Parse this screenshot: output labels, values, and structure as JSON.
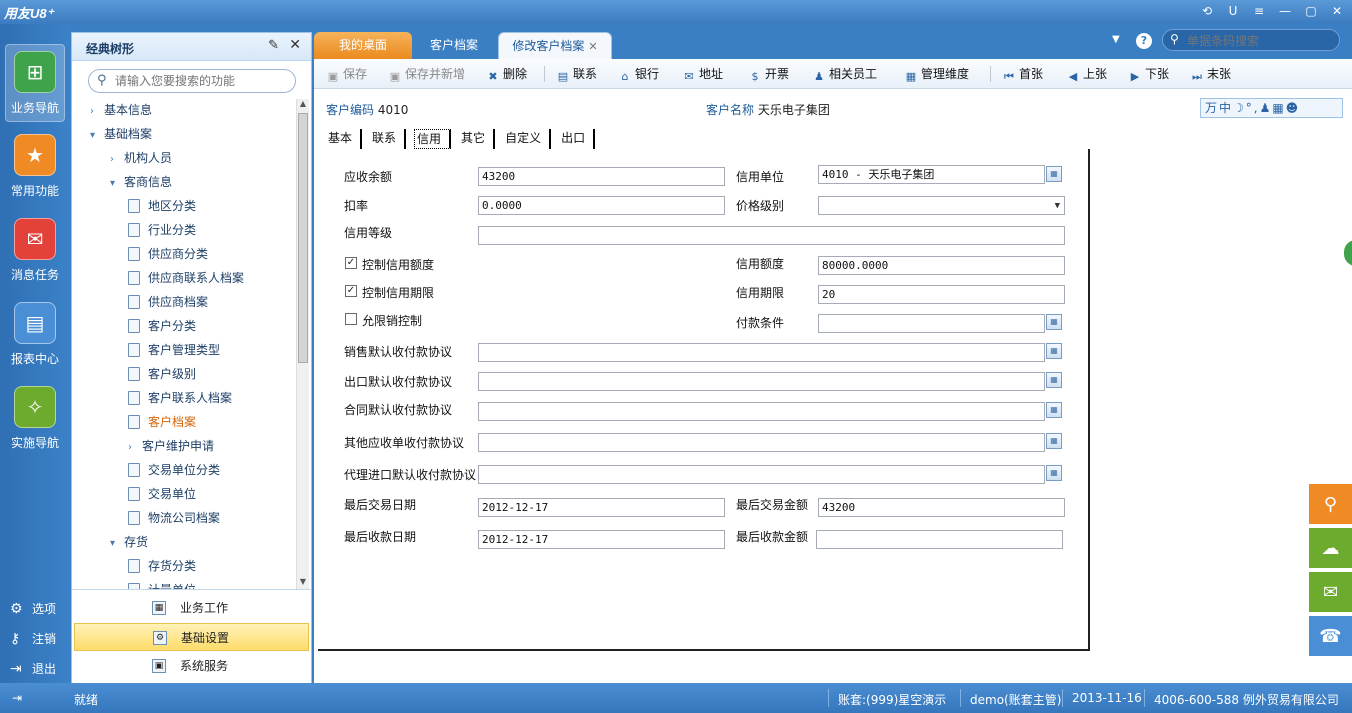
{
  "app": {
    "logo": "用友U8⁺"
  },
  "window_controls": [
    "⟲",
    "U",
    "≡",
    "—",
    "▢",
    "✕"
  ],
  "left_nav": {
    "items": [
      {
        "label": "业务导航",
        "icon": "org-chart-icon",
        "color": "#3ea34a"
      },
      {
        "label": "常用功能",
        "icon": "star-icon",
        "color": "#f08a24"
      },
      {
        "label": "消息任务",
        "icon": "mail-icon",
        "color": "#e2423a"
      },
      {
        "label": "报表中心",
        "icon": "report-icon",
        "color": "#4a8fd6"
      },
      {
        "label": "实施导航",
        "icon": "compass-icon",
        "color": "#6cab2e"
      }
    ],
    "bottom": [
      {
        "label": "选项",
        "icon": "gear-icon"
      },
      {
        "label": "注销",
        "icon": "key-icon"
      },
      {
        "label": "退出",
        "icon": "exit-icon"
      }
    ]
  },
  "tree": {
    "title": "经典树形",
    "search_placeholder": "请输入您要搜索的功能",
    "nodes": [
      {
        "label": "基本信息",
        "type": "folder",
        "level": 0,
        "expanded": false
      },
      {
        "label": "基础档案",
        "type": "folder",
        "level": 0,
        "expanded": true
      },
      {
        "label": "机构人员",
        "type": "folder",
        "level": 1,
        "expanded": false
      },
      {
        "label": "客商信息",
        "type": "folder",
        "level": 1,
        "expanded": true
      },
      {
        "label": "地区分类",
        "type": "doc",
        "level": 2
      },
      {
        "label": "行业分类",
        "type": "doc",
        "level": 2
      },
      {
        "label": "供应商分类",
        "type": "doc",
        "level": 2
      },
      {
        "label": "供应商联系人档案",
        "type": "doc",
        "level": 2
      },
      {
        "label": "供应商档案",
        "type": "doc",
        "level": 2
      },
      {
        "label": "客户分类",
        "type": "doc",
        "level": 2
      },
      {
        "label": "客户管理类型",
        "type": "doc",
        "level": 2
      },
      {
        "label": "客户级别",
        "type": "doc",
        "level": 2
      },
      {
        "label": "客户联系人档案",
        "type": "doc",
        "level": 2
      },
      {
        "label": "客户档案",
        "type": "doc",
        "level": 2,
        "selected": true
      },
      {
        "label": "客户维护申请",
        "type": "folder",
        "level": 2,
        "expanded": false
      },
      {
        "label": "交易单位分类",
        "type": "doc",
        "level": 2
      },
      {
        "label": "交易单位",
        "type": "doc",
        "level": 2
      },
      {
        "label": "物流公司档案",
        "type": "doc",
        "level": 2
      },
      {
        "label": "存货",
        "type": "folder",
        "level": 1,
        "expanded": true
      },
      {
        "label": "存货分类",
        "type": "doc",
        "level": 2
      },
      {
        "label": "计量单位",
        "type": "doc",
        "level": 2
      }
    ],
    "bottom": [
      {
        "label": "业务工作",
        "active": false
      },
      {
        "label": "基础设置",
        "active": true
      },
      {
        "label": "系统服务",
        "active": false
      }
    ]
  },
  "tabs": [
    {
      "label": "我的桌面"
    },
    {
      "label": "客户档案"
    },
    {
      "label": "修改客户档案",
      "close": "✕"
    }
  ],
  "top_search": {
    "placeholder": "单据条码搜索"
  },
  "toolbar": [
    {
      "label": "保存",
      "icon": "save-icon",
      "disabled": true
    },
    {
      "label": "保存并新增",
      "icon": "save-new-icon",
      "disabled": true
    },
    {
      "label": "删除",
      "icon": "delete-icon",
      "disabled": false
    },
    {
      "label": "联系",
      "icon": "contact-icon",
      "disabled": false
    },
    {
      "label": "银行",
      "icon": "bank-icon",
      "disabled": false
    },
    {
      "label": "地址",
      "icon": "address-icon",
      "disabled": false
    },
    {
      "label": "开票",
      "icon": "invoice-icon",
      "disabled": false
    },
    {
      "label": "相关员工",
      "icon": "staff-icon",
      "disabled": false
    },
    {
      "label": "管理维度",
      "icon": "dimension-icon",
      "disabled": false
    },
    {
      "label": "首张",
      "icon": "first-icon",
      "disabled": false
    },
    {
      "label": "上张",
      "icon": "prev-icon",
      "disabled": false
    },
    {
      "label": "下张",
      "icon": "next-icon",
      "disabled": false
    },
    {
      "label": "末张",
      "icon": "last-icon",
      "disabled": false
    }
  ],
  "header": {
    "code_label": "客户编码",
    "code_value": "4010",
    "name_label": "客户名称",
    "name_value": "天乐电子集团",
    "ime": "万中☽°,♟▦☻"
  },
  "subtabs": [
    "基本",
    "联系",
    "信用",
    "其它",
    "自定义",
    "出口"
  ],
  "form": {
    "ar_balance": {
      "label": "应收余额",
      "value": "43200"
    },
    "credit_unit": {
      "label": "信用单位",
      "value": "4010 - 天乐电子集团"
    },
    "discount": {
      "label": "扣率",
      "value": "0.0000"
    },
    "price_level": {
      "label": "价格级别",
      "value": ""
    },
    "credit_grade": {
      "label": "信用等级",
      "value": ""
    },
    "ctrl_credit_amount": {
      "label": "控制信用额度",
      "checked": true
    },
    "credit_amount": {
      "label": "信用额度",
      "value": "80000.0000"
    },
    "ctrl_credit_period": {
      "label": "控制信用期限",
      "checked": true
    },
    "credit_period": {
      "label": "信用期限",
      "value": "20"
    },
    "limit_sales": {
      "label": "允限销控制",
      "checked": false
    },
    "payment_terms": {
      "label": "付款条件",
      "value": ""
    },
    "sales_agreement": {
      "label": "销售默认收付款协议",
      "value": ""
    },
    "export_agreement": {
      "label": "出口默认收付款协议",
      "value": ""
    },
    "contract_agreement": {
      "label": "合同默认收付款协议",
      "value": ""
    },
    "other_ar_agreement": {
      "label": "其他应收单收付款协议",
      "value": ""
    },
    "agency_import_agreement": {
      "label": "代理进口默认收付款协议",
      "value": ""
    },
    "last_trade_date": {
      "label": "最后交易日期",
      "value": "2012-12-17"
    },
    "last_trade_amount": {
      "label": "最后交易金额",
      "value": "43200"
    },
    "last_receipt_date": {
      "label": "最后收款日期",
      "value": "2012-12-17"
    },
    "last_receipt_amount": {
      "label": "最后收款金额",
      "value": ""
    }
  },
  "status": {
    "ready": "就绪",
    "account": "账套:(999)星空演示",
    "user": "demo(账套主管)",
    "date": "2013-11-16",
    "company": "4006-600-588 例外贸易有限公司"
  },
  "colors": {
    "accent": "#3a7fc4",
    "tab_active": "#ea8a1e",
    "selected_node": "#d6660a",
    "dock": "#f08a24"
  }
}
